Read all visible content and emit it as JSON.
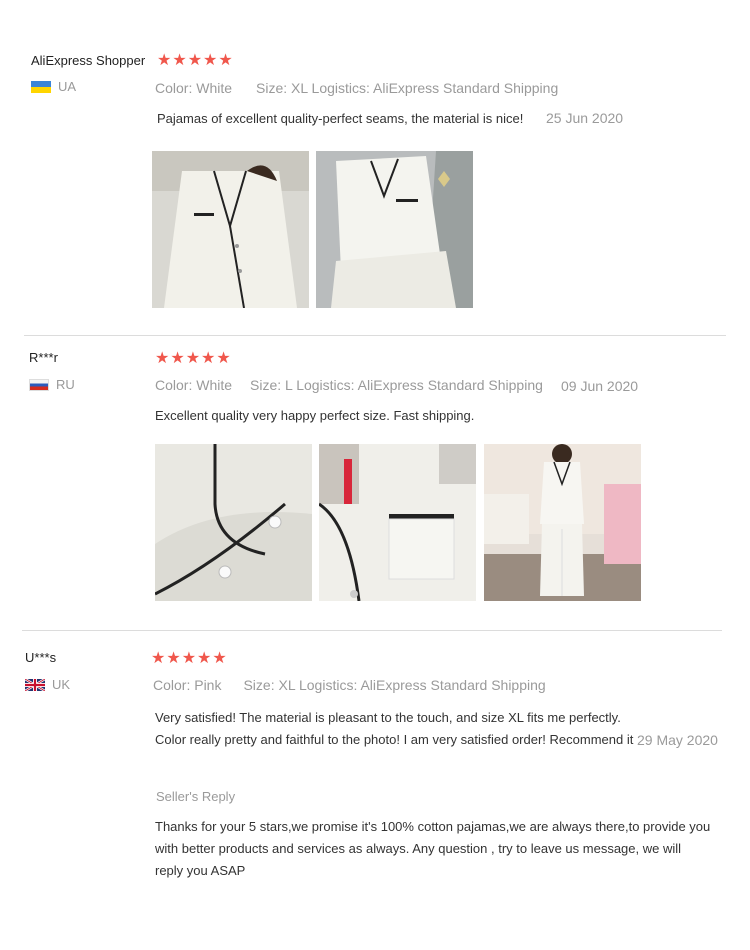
{
  "reviews": [
    {
      "name": "AliExpress Shopper",
      "country": "UA",
      "flag_icon": "ukraine-flag-icon",
      "stars": 5,
      "color": "Color: White",
      "size": "Size: XL",
      "logistics": "Logistics: AliExpress Standard Shipping",
      "text": "Pajamas of excellent quality-perfect seams, the material is nice!",
      "date": "25 Jun 2020",
      "photos": [
        "person-in-white-pajama-shirt",
        "white-pajama-set-on-bed"
      ]
    },
    {
      "name": "R***r",
      "country": "RU",
      "flag_icon": "russia-flag-icon",
      "stars": 5,
      "color": "Color: White",
      "size": "Size: L",
      "logistics": "Logistics: AliExpress Standard Shipping",
      "text": "Excellent quality very happy perfect size. Fast shipping.",
      "date": "09  Jun 2020",
      "photos": [
        "pajama-sleeve-closeup",
        "pajama-pocket-closeup",
        "person-wearing-white-pajamas"
      ]
    },
    {
      "name": "U***s",
      "country": "UK",
      "flag_icon": "uk-flag-icon",
      "stars": 5,
      "color": "Color: Pink",
      "size": "Size: XL",
      "logistics": "Logistics: AliExpress Standard Shipping",
      "text_line1": "Very satisfied! The material is pleasant to the touch, and size XL fits me perfectly.",
      "text_line2": "Color really pretty and faithful to the photo! I am very satisfied order! Recommend it",
      "date": "29  May 2020",
      "seller_reply_title": "Seller's Reply",
      "seller_reply_line1": "Thanks for your 5 stars,we promise it's 100% cotton pajamas,we are always there,to provide you",
      "seller_reply_line2": "with better products and services as always. Any question , try to leave us message, we will",
      "seller_reply_line3": "reply you ASAP"
    }
  ],
  "star_glyph": "★",
  "colors": {
    "star": "#f0574c",
    "muted": "#9a9a9a",
    "divider": "#dcdcdc"
  }
}
